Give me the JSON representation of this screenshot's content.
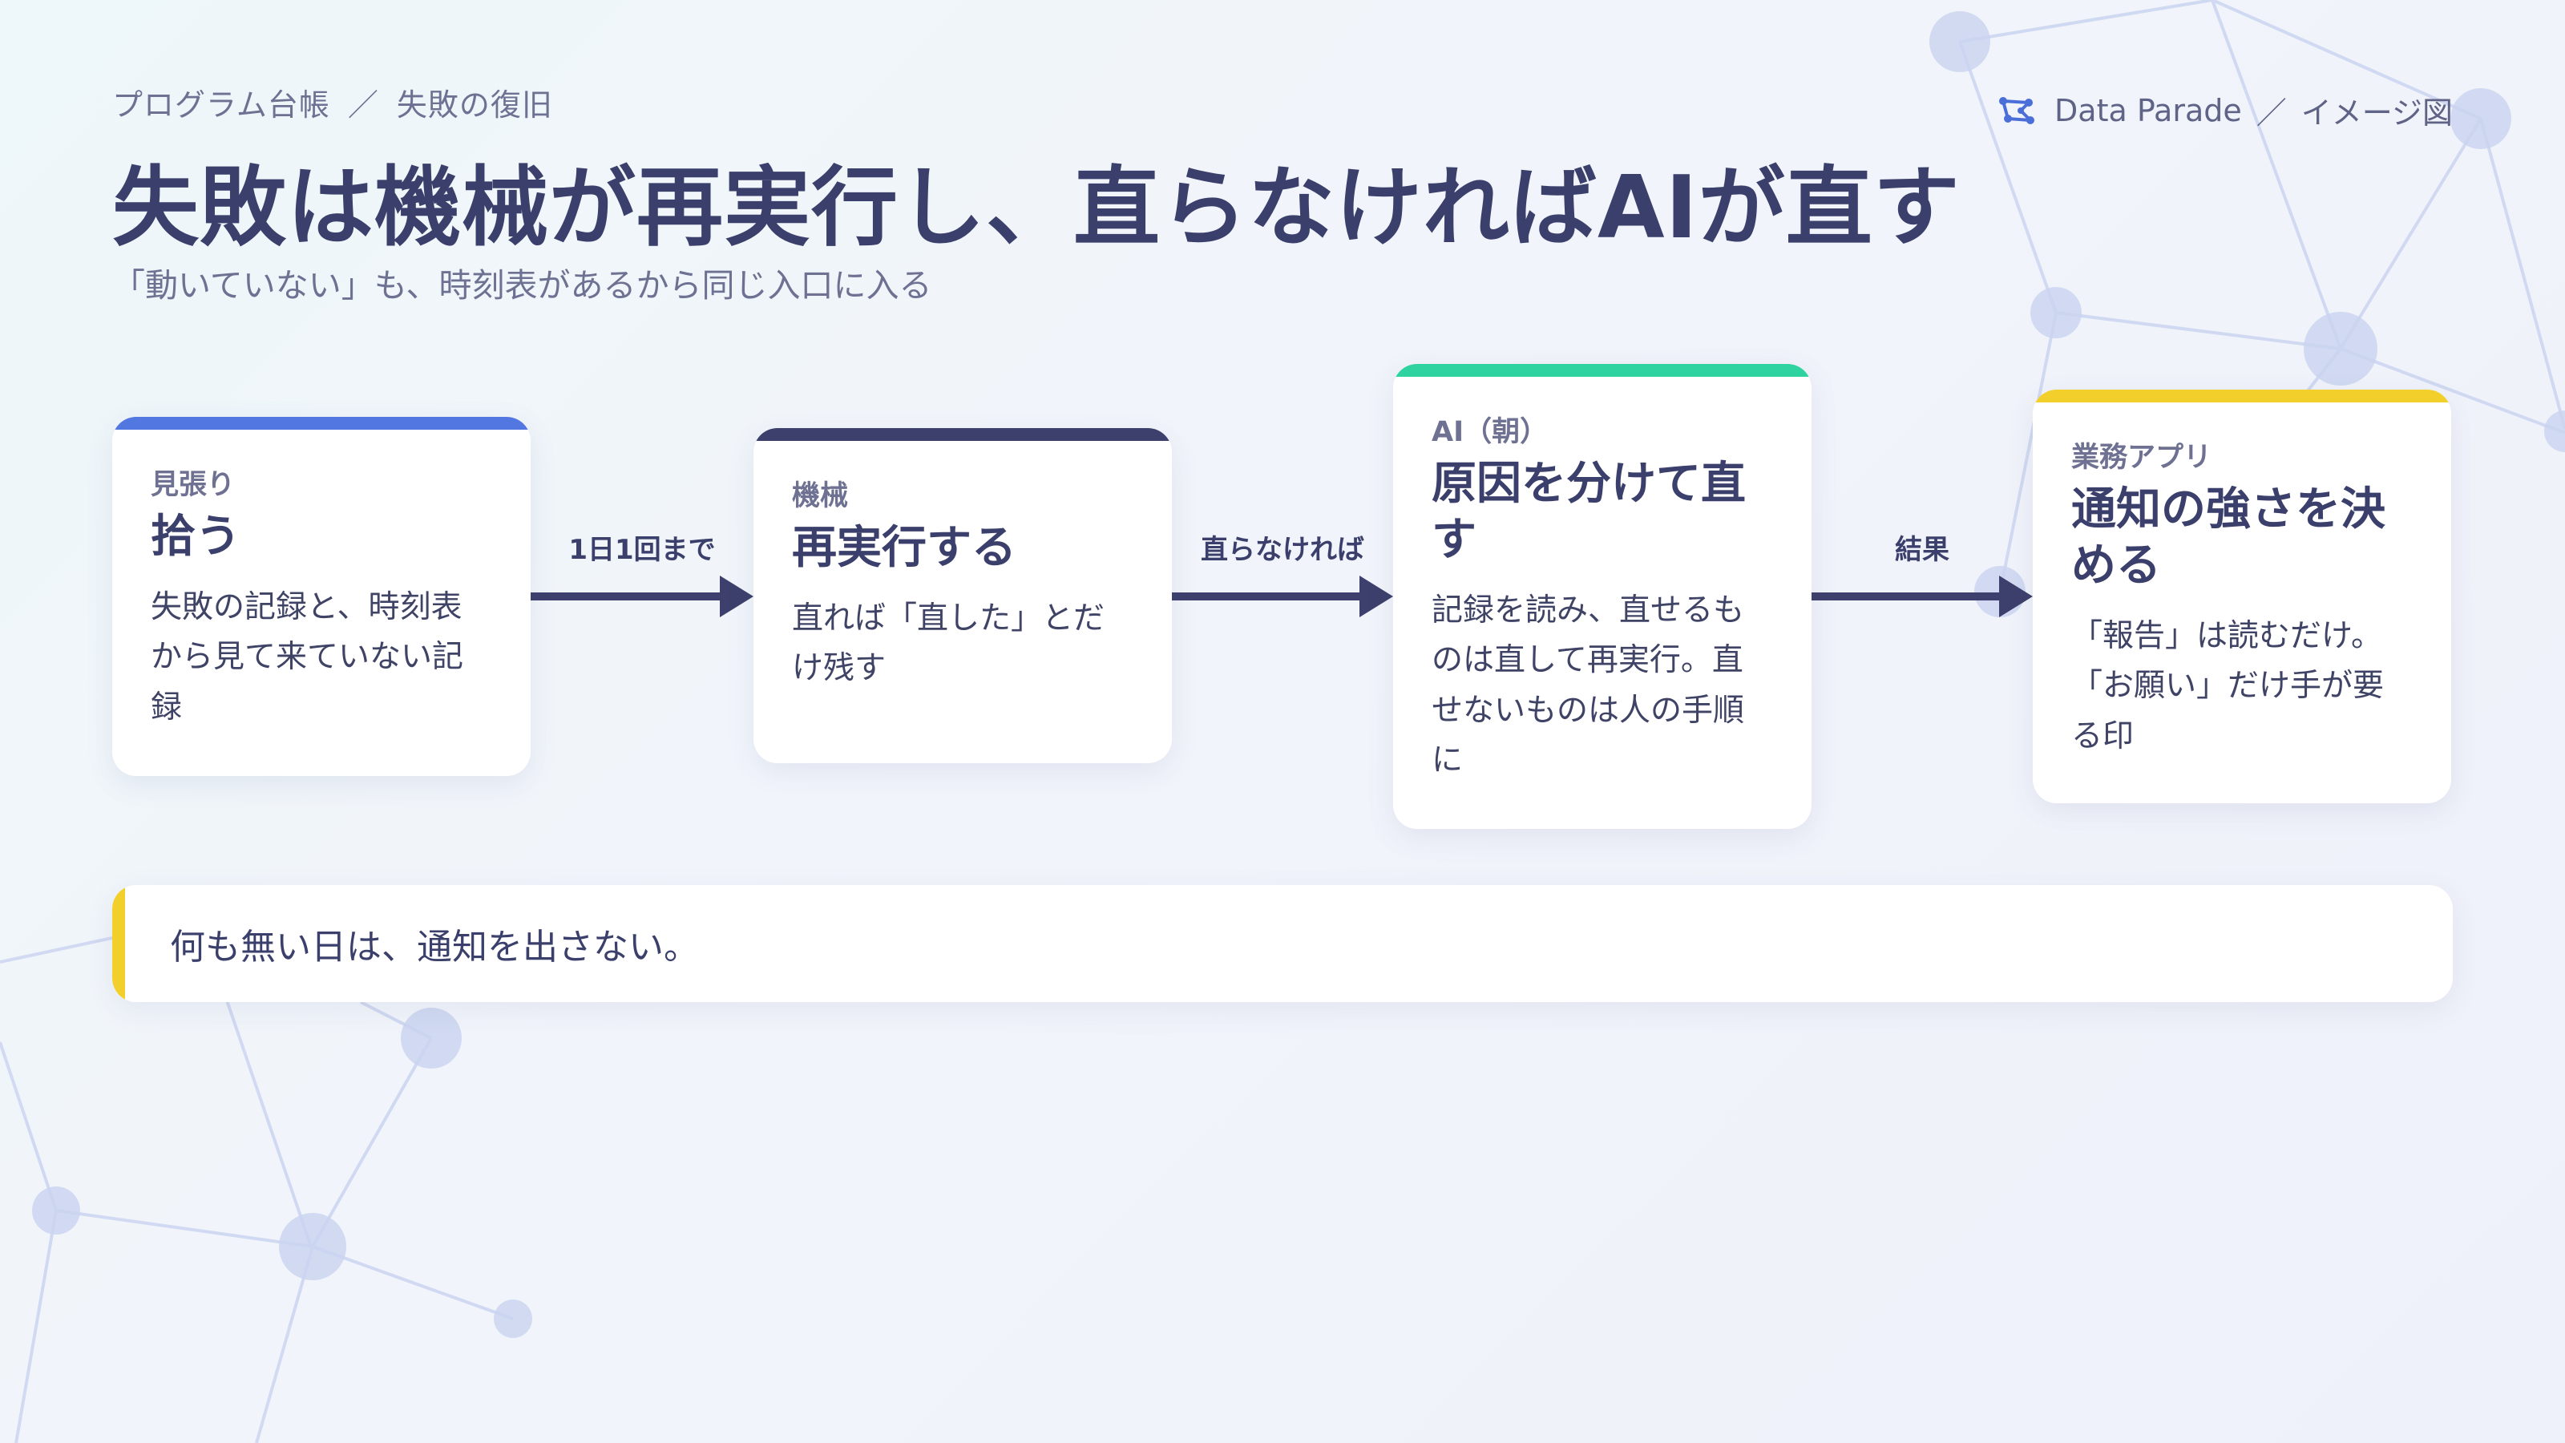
{
  "breadcrumb": {
    "program": "プログラム台帳",
    "separator": "／",
    "page": "失敗の復旧"
  },
  "brand": {
    "name": "Data Parade",
    "separator": "／",
    "kind": "イメージ図",
    "icon": "constellation-logo-icon"
  },
  "title": "失敗は機械が再実行し、直らなければAIが直す",
  "subtitle": "「動いていない」も、時刻表があるから同じ入口に入る",
  "colors": {
    "navy": "#3b3f6b",
    "blue": "#5377e0",
    "dark": "#3d3f6c",
    "green": "#2ed3a0",
    "yellow": "#f2cf2b"
  },
  "steps": [
    {
      "role": "見張り",
      "heading": "拾う",
      "description": "失敗の記録と、時刻表から見て来ていない記録",
      "accent": "#5377e0"
    },
    {
      "role": "機械",
      "heading": "再実行する",
      "description": "直れば「直した」とだけ残す",
      "accent": "#3d3f6c"
    },
    {
      "role": "AI（朝）",
      "heading": "原因を分けて直す",
      "description": "記録を読み、直せるものは直して再実行。直せないものは人の手順に",
      "accent": "#2ed3a0"
    },
    {
      "role": "業務アプリ",
      "heading": "通知の強さを決める",
      "description": "「報告」は読むだけ。「お願い」だけ手が要る印",
      "accent": "#f2cf2b"
    }
  ],
  "connectors": [
    "1日1回まで",
    "直らなければ",
    "結果"
  ],
  "note": "何も無い日は、通知を出さない。"
}
